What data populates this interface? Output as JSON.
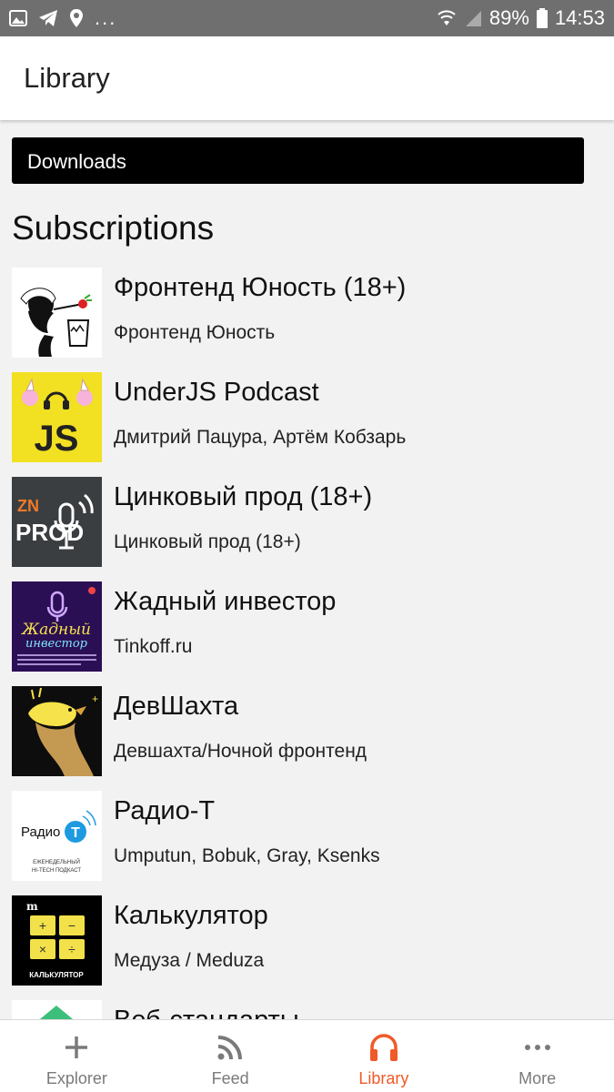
{
  "status_bar": {
    "more_dots": "...",
    "battery": "89%",
    "time": "14:53",
    "icons": [
      "image-icon",
      "telegram-icon",
      "location-icon",
      "wifi-icon",
      "signal-icon",
      "battery-icon"
    ]
  },
  "header": {
    "title": "Library"
  },
  "downloads": {
    "label": "Downloads"
  },
  "subscriptions": {
    "title": "Subscriptions",
    "items": [
      {
        "title": "Фронтенд Юность (18+)",
        "author": "Фронтенд Юность",
        "cover": "frontend-unost-cover"
      },
      {
        "title": "UnderJS Podcast",
        "author": "Дмитрий Пацура, Артём Кобзарь",
        "cover": "underjs-cover",
        "cover_text": "JS"
      },
      {
        "title": "Цинковый прод (18+)",
        "author": "Цинковый прод (18+)",
        "cover": "zinc-prod-cover",
        "cover_text_1": "ZN",
        "cover_text_2": "PROD"
      },
      {
        "title": "Жадный инвестор",
        "author": "Tinkoff.ru",
        "cover": "greedy-investor-cover",
        "cover_text_1": "Жадный",
        "cover_text_2": "инвестор"
      },
      {
        "title": "ДевШахта",
        "author": "Девшахта/Ночной фронтенд",
        "cover": "devshahta-cover"
      },
      {
        "title": "Радио-Т",
        "author": "Umputun, Bobuk, Gray, Ksenks",
        "cover": "radio-t-cover",
        "cover_text_1": "Радио",
        "cover_text_2": "T",
        "cover_text_3": "ЕЖЕНЕДЕЛЬНЫЙ",
        "cover_text_4": "HI-TECH ПОДКАСТ"
      },
      {
        "title": "Калькулятор",
        "author": "Медуза / Meduza",
        "cover": "calculator-cover",
        "cover_text_1": "m",
        "cover_text_2": "КАЛЬКУЛЯТОР"
      },
      {
        "title": "Веб-стандарты",
        "author": "",
        "cover": "web-standards-cover"
      }
    ]
  },
  "bottom_nav": {
    "items": [
      {
        "label": "Explorer",
        "icon": "plus-icon",
        "active": false
      },
      {
        "label": "Feed",
        "icon": "rss-icon",
        "active": false
      },
      {
        "label": "Library",
        "icon": "headphones-icon",
        "active": true
      },
      {
        "label": "More",
        "icon": "more-dots-icon",
        "active": false
      }
    ]
  },
  "colors": {
    "accent": "#f05a28",
    "status_bar": "#6f6f6f",
    "background": "#f2f2f2"
  }
}
